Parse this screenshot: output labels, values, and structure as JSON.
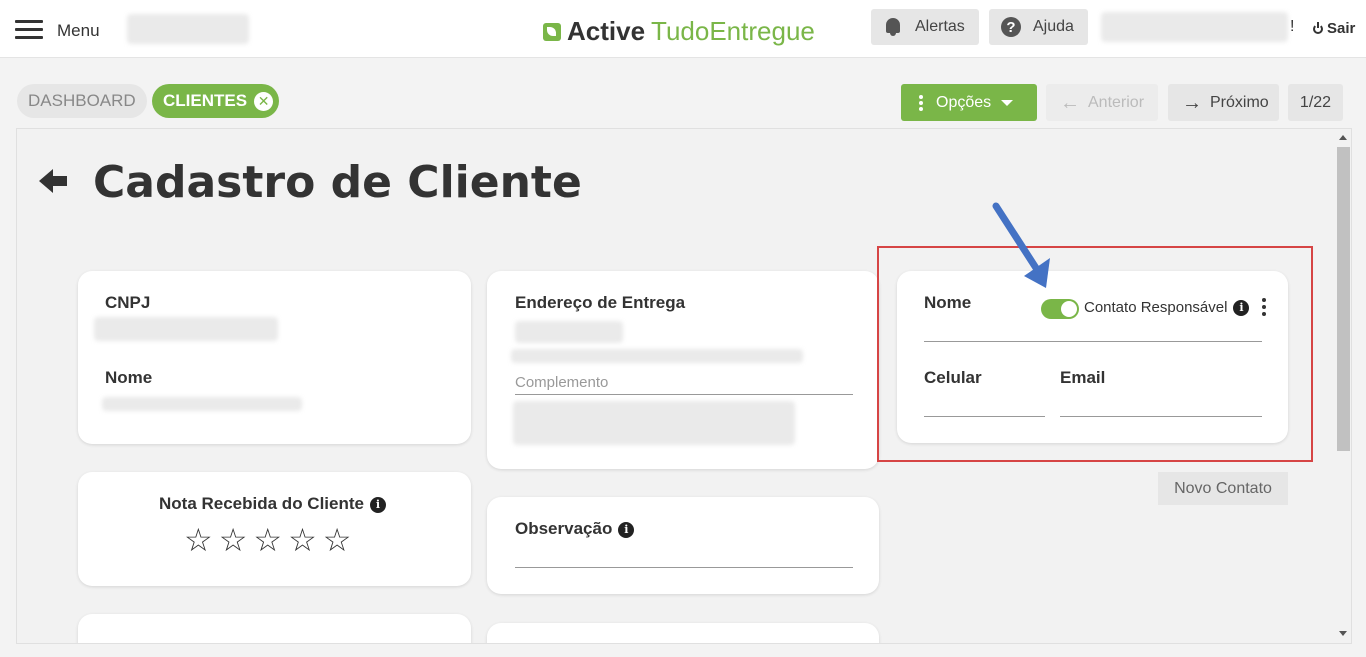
{
  "header": {
    "menu_label": "Menu",
    "logo_part1": "Active",
    "logo_part2": "TudoEntregue",
    "alerts_label": "Alertas",
    "help_label": "Ajuda",
    "exclamation": "!",
    "logout_label": "Sair",
    "icons": {
      "menu": "hamburger-icon",
      "logo": "leaf-icon",
      "alerts": "bell-icon",
      "help": "question-icon",
      "logout": "power-icon"
    }
  },
  "breadcrumb": {
    "dashboard_label": "DASHBOARD",
    "clients_label": "CLIENTES",
    "clients_close": "✕"
  },
  "toolbar": {
    "options_label": "Opções",
    "previous_label": "Anterior",
    "next_label": "Próximo",
    "page_indicator": "1/22"
  },
  "page": {
    "title": "Cadastro de Cliente"
  },
  "client_card": {
    "cnpj_label": "CNPJ",
    "name_label": "Nome"
  },
  "address_card": {
    "title": "Endereço de Entrega",
    "complement_placeholder": "Complemento"
  },
  "rating_card": {
    "title": "Nota Recebida do Cliente",
    "info": "i",
    "stars": [
      "☆",
      "☆",
      "☆",
      "☆",
      "☆"
    ]
  },
  "observation_card": {
    "title": "Observação",
    "info": "i"
  },
  "contact_card": {
    "name_label": "Nome",
    "toggle_label": "Contato Responsável",
    "toggle_on": true,
    "info": "i",
    "phone_label": "Celular",
    "email_label": "Email"
  },
  "new_contact_label": "Novo Contato",
  "colors": {
    "accent": "#7ab648",
    "highlight": "#d64545",
    "annotation_arrow": "#4472c4"
  }
}
